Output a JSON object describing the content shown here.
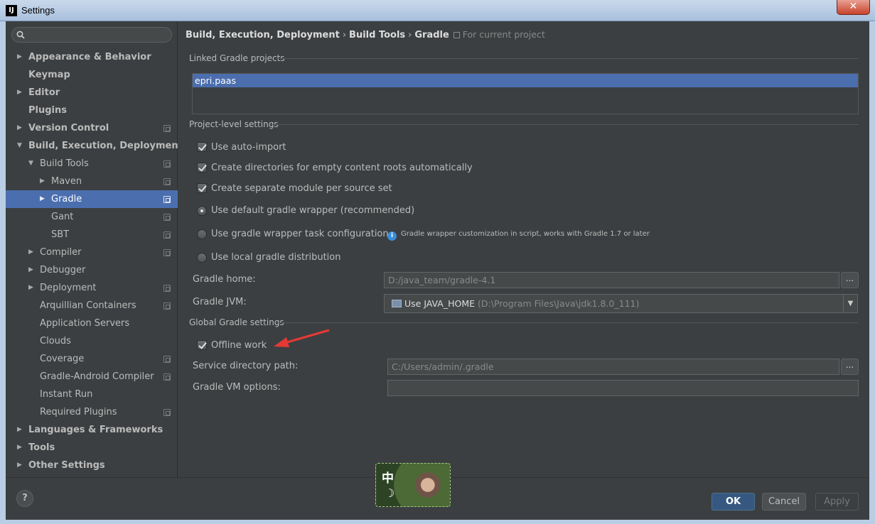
{
  "window": {
    "title": "Settings",
    "close_label": "✕"
  },
  "sidebar": {
    "search_placeholder": "",
    "items": [
      {
        "label": "Appearance & Behavior",
        "bold": true,
        "arrow": "▶",
        "depth": 0
      },
      {
        "label": "Keymap",
        "bold": true,
        "arrow": "",
        "depth": 0
      },
      {
        "label": "Editor",
        "bold": true,
        "arrow": "▶",
        "depth": 0
      },
      {
        "label": "Plugins",
        "bold": true,
        "arrow": "",
        "depth": 0
      },
      {
        "label": "Version Control",
        "bold": true,
        "arrow": "▶",
        "depth": 0,
        "project": true
      },
      {
        "label": "Build, Execution, Deployment",
        "bold": true,
        "arrow": "▼",
        "depth": 0
      },
      {
        "label": "Build Tools",
        "arrow": "▼",
        "depth": 1,
        "project": true
      },
      {
        "label": "Maven",
        "arrow": "▶",
        "depth": 2,
        "project": true
      },
      {
        "label": "Gradle",
        "arrow": "▶",
        "depth": 2,
        "project": true,
        "selected": true
      },
      {
        "label": "Gant",
        "arrow": "",
        "depth": 2,
        "project": true
      },
      {
        "label": "SBT",
        "arrow": "",
        "depth": 2,
        "project": true
      },
      {
        "label": "Compiler",
        "arrow": "▶",
        "depth": 1,
        "project": true
      },
      {
        "label": "Debugger",
        "arrow": "▶",
        "depth": 1
      },
      {
        "label": "Deployment",
        "arrow": "▶",
        "depth": 1,
        "project": true
      },
      {
        "label": "Arquillian Containers",
        "arrow": "",
        "depth": 1,
        "project": true
      },
      {
        "label": "Application Servers",
        "arrow": "",
        "depth": 1
      },
      {
        "label": "Clouds",
        "arrow": "",
        "depth": 1
      },
      {
        "label": "Coverage",
        "arrow": "",
        "depth": 1,
        "project": true
      },
      {
        "label": "Gradle-Android Compiler",
        "arrow": "",
        "depth": 1,
        "project": true
      },
      {
        "label": "Instant Run",
        "arrow": "",
        "depth": 1
      },
      {
        "label": "Required Plugins",
        "arrow": "",
        "depth": 1,
        "project": true
      },
      {
        "label": "Languages & Frameworks",
        "bold": true,
        "arrow": "▶",
        "depth": 0
      },
      {
        "label": "Tools",
        "bold": true,
        "arrow": "▶",
        "depth": 0
      },
      {
        "label": "Other Settings",
        "bold": true,
        "arrow": "▶",
        "depth": 0
      }
    ]
  },
  "breadcrumb": {
    "part1": "Build, Execution, Deployment",
    "part2": "Build Tools",
    "part3": "Gradle",
    "separator": "›",
    "scope": "For current project"
  },
  "linked_projects": {
    "title": "Linked Gradle projects",
    "items": [
      "epri.paas"
    ]
  },
  "project_settings": {
    "title": "Project-level settings",
    "use_auto_import": "Use auto-import",
    "create_dirs": "Create directories for empty content roots automatically",
    "separate_module": "Create separate module per source set",
    "default_wrapper": "Use default gradle wrapper (recommended)",
    "wrapper_task": "Use gradle wrapper task configuration",
    "wrapper_hint": "Gradle wrapper customization in script, works with Gradle 1.7 or later",
    "local_distribution": "Use local gradle distribution",
    "gradle_home_label": "Gradle home:",
    "gradle_home_value": "D:/java_team/gradle-4.1",
    "gradle_jvm_label": "Gradle JVM:",
    "gradle_jvm_value": "Use JAVA_HOME",
    "gradle_jvm_path": "(D:\\Program Files\\Java\\jdk1.8.0_111)"
  },
  "global_settings": {
    "title": "Global Gradle settings",
    "offline_work": "Offline work",
    "service_dir_label": "Service directory path:",
    "service_dir_value": "C:/Users/admin/.gradle",
    "vm_options_label": "Gradle VM options:",
    "vm_options_value": ""
  },
  "buttons": {
    "help": "?",
    "ok": "OK",
    "cancel": "Cancel",
    "apply": "Apply",
    "browse": "..."
  },
  "colors": {
    "selection": "#4b6eaf",
    "background": "#3c3f41",
    "accent_arrow": "#e53935"
  }
}
